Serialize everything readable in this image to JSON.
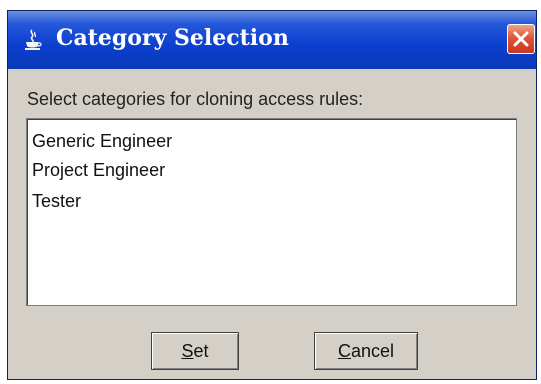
{
  "window": {
    "title": "Category Selection",
    "close_icon": "close-icon",
    "title_icon": "java-coffee-icon"
  },
  "instruction": "Select categories for cloning access rules:",
  "categories": [
    {
      "label": "Generic Engineer"
    },
    {
      "label": "Project Engineer"
    },
    {
      "label": "Tester"
    }
  ],
  "buttons": {
    "set": {
      "mnemonic": "S",
      "rest": "et"
    },
    "cancel": {
      "mnemonic": "C",
      "rest": "ancel"
    }
  },
  "colors": {
    "titlebar": "#0b3fcf",
    "close_button": "#e0553b",
    "dialog_background": "#d4d0c8",
    "list_background": "#ffffff"
  }
}
